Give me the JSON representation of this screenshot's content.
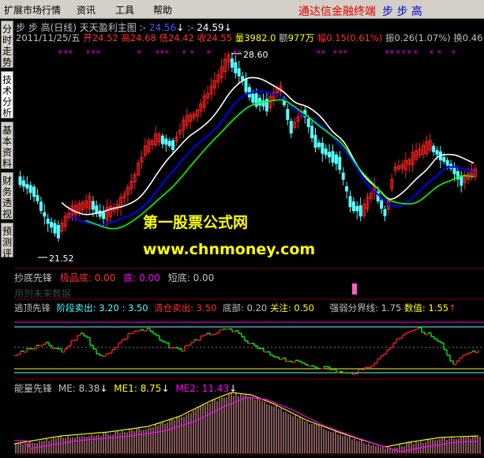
{
  "menu": {
    "items": [
      "扩展市场行情",
      "资讯",
      "工具",
      "帮助"
    ],
    "brand": "通达信金融终端",
    "brand_code": "步 步 高"
  },
  "sidebar": {
    "tabs": [
      "分时走势",
      "技术分析",
      "基本资料",
      "财务透视",
      "预测评级"
    ]
  },
  "main_panel": {
    "title": "步 步 高(日线) 天天盈利主图",
    "ind1_label": ":-",
    "ind1_value": "24.56",
    "ind2_label": ":-",
    "ind2_value": "24.59",
    "date": "2011/11/25/五",
    "open_label": "开",
    "open": "24.52",
    "high_label": "高",
    "high": "24.68",
    "low_label": "低",
    "low": "24.42",
    "close_label": "收",
    "close": "24.55",
    "vol_label": "量",
    "vol": "3982.0",
    "amt_label": "额",
    "amt": "977万",
    "chg_label": "幅",
    "chg": "0.15(0.61%)",
    "amp_label": "振",
    "amp": "0.26(1.07%)",
    "turn_label": "换",
    "turn": "0.46",
    "peak_label": "28.60",
    "trough_label": "21.52",
    "watermark_cn": "第一股票公式网",
    "watermark_url": "www.chnmoney.com"
  },
  "panel2": {
    "name": "抄底先锋",
    "a_label": "极品底:",
    "a_value": "0.00",
    "b_label": "底:",
    "b_value": "0.00",
    "c_label": "短底:",
    "c_value": "0.00",
    "note": "用到未来数据"
  },
  "panel3": {
    "name": "逃顶先锋",
    "a_label": "阶段卖出:",
    "a_value1": "3.20",
    "a_sep": ":",
    "a_value2": "3.50",
    "b_label": "清仓卖出:",
    "b_value": "3.50",
    "c_label": "底部:",
    "c_value": "0.20",
    "d_label": "关注:",
    "d_value": "0.50",
    "e_label": "强弱分界线:",
    "e_value": "1.75",
    "f_label": "数值:",
    "f_value": "1.55"
  },
  "panel4": {
    "name": "能量先锋",
    "me_label": "ME:",
    "me_value": "8.38",
    "me1_label": "ME1:",
    "me1_value": "8.75",
    "me2_label": "ME2:",
    "me2_value": "11.43"
  },
  "colors": {
    "up": "#ff2020",
    "down": "#54ffff",
    "ma_white": "#ffffff",
    "ma_blue": "#0000ff",
    "ma_green": "#00ff00",
    "magenta": "#ff00ff",
    "yellow": "#ffff00",
    "grid": "#800000"
  }
}
